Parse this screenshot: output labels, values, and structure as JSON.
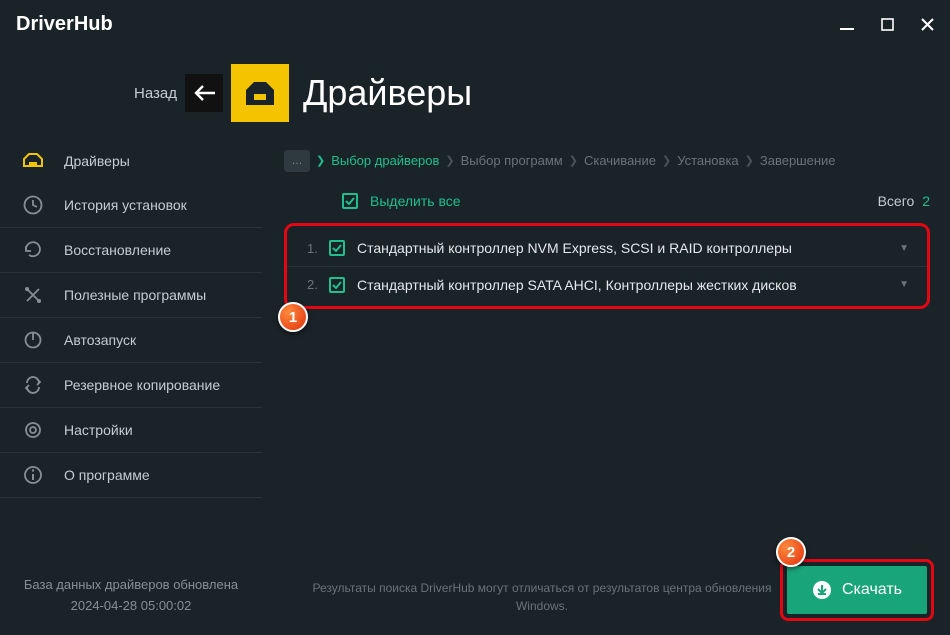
{
  "app": {
    "title": "DriverHub"
  },
  "header": {
    "back": "Назад",
    "title": "Драйверы"
  },
  "sidebar": {
    "items": [
      {
        "label": "Драйверы"
      },
      {
        "label": "История установок"
      },
      {
        "label": "Восстановление"
      },
      {
        "label": "Полезные программы"
      },
      {
        "label": "Автозапуск"
      },
      {
        "label": "Резервное копирование"
      },
      {
        "label": "Настройки"
      },
      {
        "label": "О программе"
      }
    ],
    "footer_line1": "База данных драйверов обновлена",
    "footer_line2": "2024-04-28 05:00:02"
  },
  "breadcrumb": {
    "more": "…",
    "items": [
      {
        "label": "Выбор драйверов",
        "active": true
      },
      {
        "label": "Выбор программ"
      },
      {
        "label": "Скачивание"
      },
      {
        "label": "Установка"
      },
      {
        "label": "Завершение"
      }
    ],
    "sep": "❯"
  },
  "selectall": {
    "label": "Выделить все",
    "total_label": "Всего",
    "total_count": "2"
  },
  "drivers": [
    {
      "num": "1.",
      "name": "Стандартный контроллер NVM Express, SCSI и RAID контроллеры"
    },
    {
      "num": "2.",
      "name": "Стандартный контроллер SATA AHCI, Контроллеры жестких дисков"
    }
  ],
  "disclaimer": "Результаты поиска DriverHub могут отличаться от результатов центра обновления Windows.",
  "download": "Скачать",
  "callouts": {
    "c1": "1",
    "c2": "2"
  }
}
